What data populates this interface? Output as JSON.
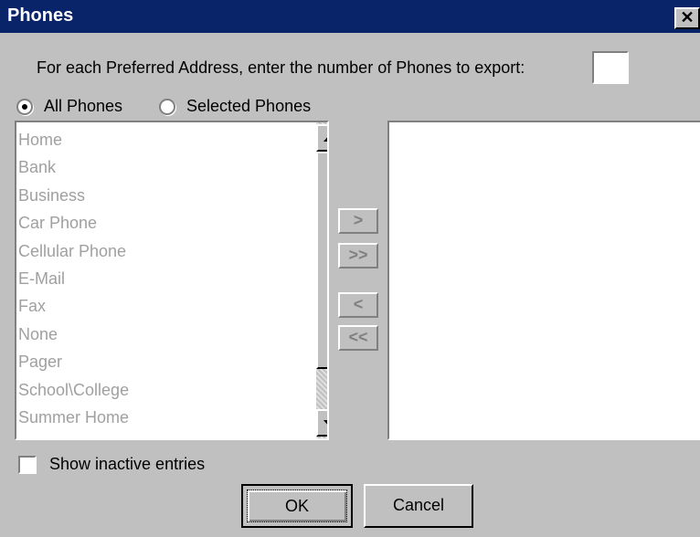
{
  "window": {
    "title": "Phones",
    "close_glyph": "✕"
  },
  "prompt": {
    "text": "For each Preferred Address, enter the number of Phones to export:",
    "count_value": ""
  },
  "filter": {
    "options": [
      {
        "label": "All Phones",
        "checked": true
      },
      {
        "label": "Selected Phones",
        "checked": false
      }
    ]
  },
  "available_list": {
    "items": [
      "Home",
      "Bank",
      "Business",
      "Car Phone",
      "Cellular Phone",
      "E-Mail",
      "Fax",
      "None",
      "Pager",
      "School\\College",
      "Summer Home"
    ]
  },
  "move_buttons": {
    "add": ">",
    "add_all": ">>",
    "remove": "<",
    "remove_all": "<<"
  },
  "selected_list": {
    "items": []
  },
  "options": {
    "show_inactive_label": "Show inactive entries",
    "show_inactive_checked": false
  },
  "buttons": {
    "ok": "OK",
    "cancel": "Cancel"
  }
}
